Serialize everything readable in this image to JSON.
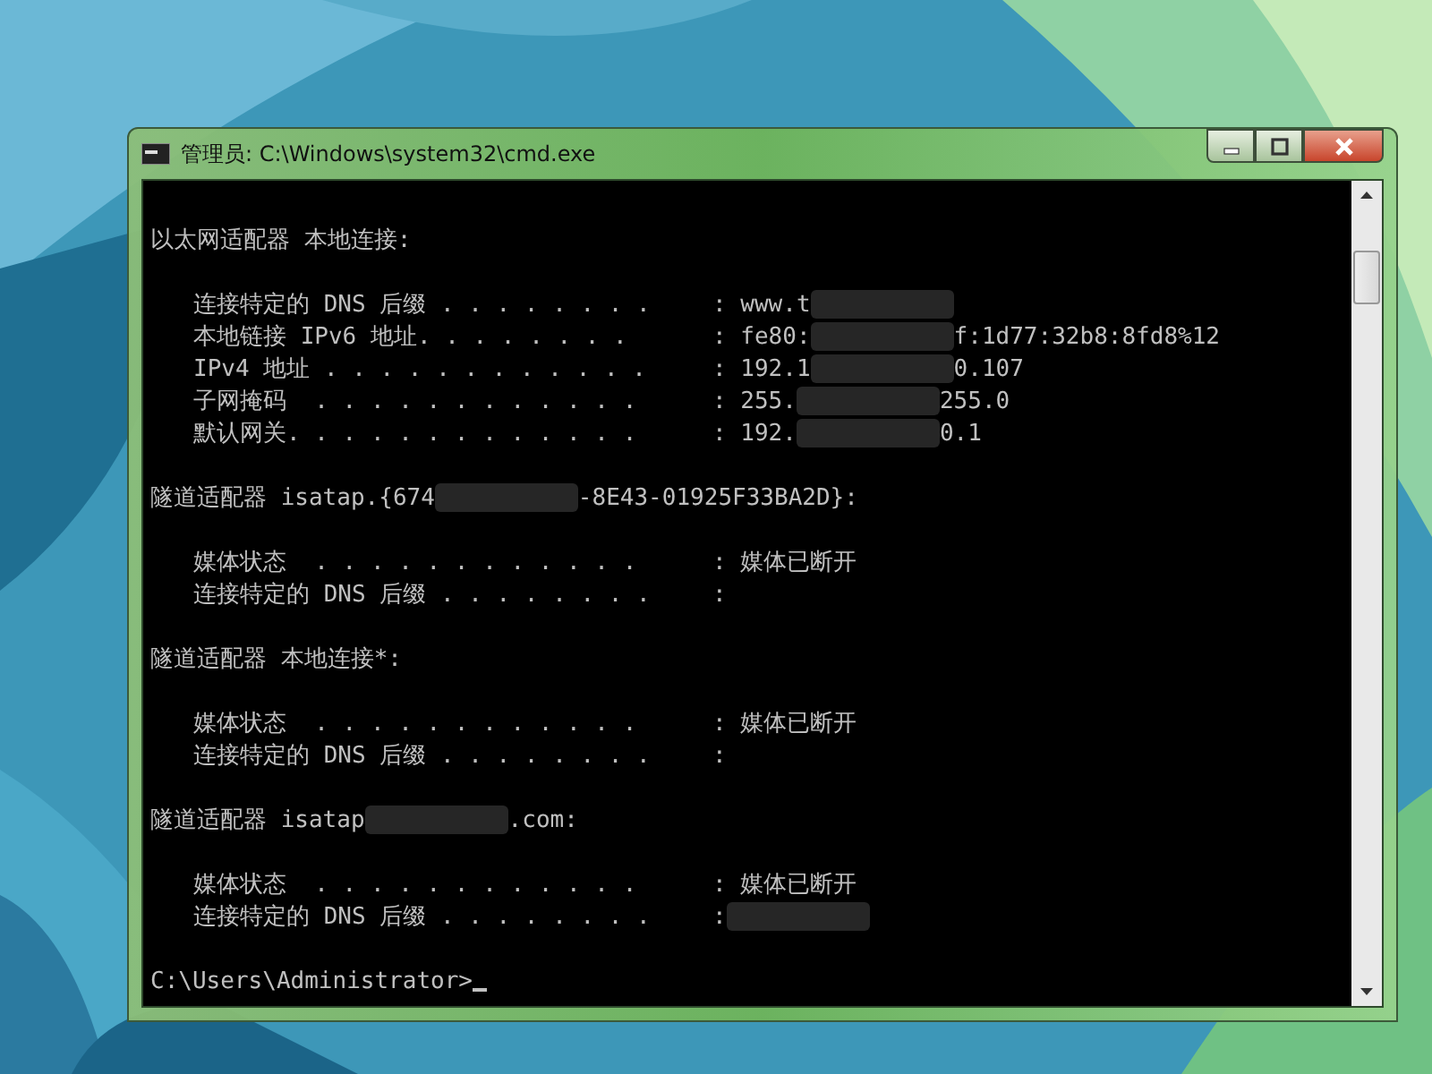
{
  "window": {
    "title": "管理员: C:\\Windows\\system32\\cmd.exe",
    "controls": [
      {
        "kind": "minimize"
      },
      {
        "kind": "maximize"
      },
      {
        "kind": "close"
      }
    ]
  },
  "console": {
    "lines": [
      {
        "kind": "heading",
        "segments": [
          {
            "kind": "text",
            "text": "以太网适配器 本地连接:"
          }
        ]
      },
      {
        "kind": "entry",
        "label": "连接特定的 DNS 后缀 . . . . . . . .",
        "segments": [
          {
            "kind": "text",
            "text": ": www.t"
          },
          {
            "kind": "redacted"
          }
        ]
      },
      {
        "kind": "entry",
        "label": "本地链接 IPv6 地址. . . . . . . .",
        "segments": [
          {
            "kind": "text",
            "text": ": fe80:"
          },
          {
            "kind": "redacted"
          },
          {
            "kind": "text",
            "text": "f:1d77:32b8:8fd8%12"
          }
        ]
      },
      {
        "kind": "entry",
        "label": "IPv4 地址 . . . . . . . . . . . .",
        "segments": [
          {
            "kind": "text",
            "text": ": 192.1"
          },
          {
            "kind": "redacted"
          },
          {
            "kind": "text",
            "text": "0.107"
          }
        ]
      },
      {
        "kind": "entry",
        "label": "子网掩码  . . . . . . . . . . . .",
        "segments": [
          {
            "kind": "text",
            "text": ": 255."
          },
          {
            "kind": "redacted"
          },
          {
            "kind": "text",
            "text": "255.0"
          }
        ]
      },
      {
        "kind": "entry",
        "label": "默认网关. . . . . . . . . . . . .",
        "segments": [
          {
            "kind": "text",
            "text": ": 192."
          },
          {
            "kind": "redacted"
          },
          {
            "kind": "text",
            "text": "0.1"
          }
        ]
      },
      {
        "kind": "heading",
        "segments": [
          {
            "kind": "text",
            "text": "隧道适配器 isatap.{674"
          },
          {
            "kind": "redacted"
          },
          {
            "kind": "text",
            "text": "-8E43-01925F33BA2D}:"
          }
        ]
      },
      {
        "kind": "entry",
        "label": "媒体状态  . . . . . . . . . . . .",
        "segments": [
          {
            "kind": "text",
            "text": ": 媒体已断开"
          }
        ]
      },
      {
        "kind": "entry",
        "label": "连接特定的 DNS 后缀 . . . . . . . .",
        "segments": [
          {
            "kind": "text",
            "text": ":"
          }
        ]
      },
      {
        "kind": "heading",
        "segments": [
          {
            "kind": "text",
            "text": "隧道适配器 本地连接*:"
          }
        ]
      },
      {
        "kind": "entry",
        "label": "媒体状态  . . . . . . . . . . . .",
        "segments": [
          {
            "kind": "text",
            "text": ": 媒体已断开"
          }
        ]
      },
      {
        "kind": "entry",
        "label": "连接特定的 DNS 后缀 . . . . . . . .",
        "segments": [
          {
            "kind": "text",
            "text": ":"
          }
        ]
      },
      {
        "kind": "heading",
        "segments": [
          {
            "kind": "text",
            "text": "隧道适配器 isatap"
          },
          {
            "kind": "redacted"
          },
          {
            "kind": "text",
            "text": ".com:"
          }
        ]
      },
      {
        "kind": "entry",
        "label": "媒体状态  . . . . . . . . . . . .",
        "segments": [
          {
            "kind": "text",
            "text": ": 媒体已断开"
          }
        ]
      },
      {
        "kind": "entry",
        "label": "连接特定的 DNS 后缀 . . . . . . . .",
        "segments": [
          {
            "kind": "text",
            "text": ":"
          },
          {
            "kind": "redacted"
          }
        ]
      },
      {
        "kind": "prompt",
        "segments": [
          {
            "kind": "text",
            "text": "C:\\Users\\Administrator>"
          }
        ]
      }
    ]
  }
}
